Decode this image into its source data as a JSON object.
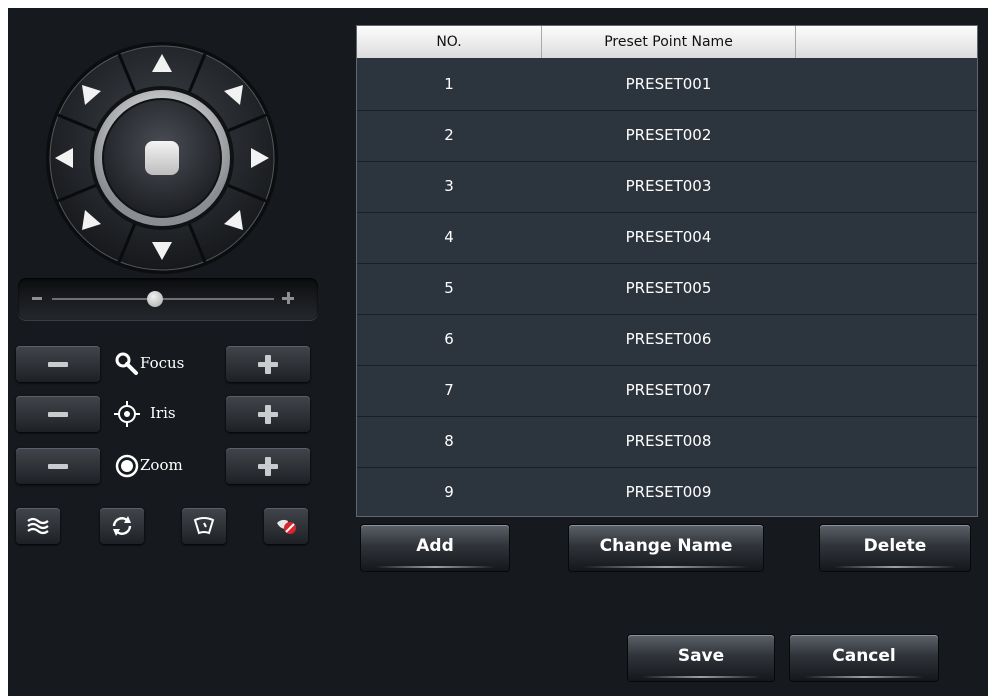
{
  "ptz": {
    "directions": [
      "up",
      "up-right",
      "right",
      "down-right",
      "down",
      "down-left",
      "left",
      "up-left"
    ]
  },
  "speed_slider": {
    "value_fraction": 0.5
  },
  "controls": [
    {
      "label": "Focus",
      "icon": "focus-icon"
    },
    {
      "label": "Iris",
      "icon": "iris-icon"
    },
    {
      "label": "Zoom",
      "icon": "zoom-icon"
    }
  ],
  "tools": [
    "wiper-icon",
    "auto-scan-icon",
    "light-icon",
    "clear-icon"
  ],
  "table": {
    "columns": [
      "NO.",
      "Preset Point Name",
      ""
    ],
    "rows": [
      {
        "no": "1",
        "name": "PRESET001"
      },
      {
        "no": "2",
        "name": "PRESET002"
      },
      {
        "no": "3",
        "name": "PRESET003"
      },
      {
        "no": "4",
        "name": "PRESET004"
      },
      {
        "no": "5",
        "name": "PRESET005"
      },
      {
        "no": "6",
        "name": "PRESET006"
      },
      {
        "no": "7",
        "name": "PRESET007"
      },
      {
        "no": "8",
        "name": "PRESET008"
      },
      {
        "no": "9",
        "name": "PRESET009"
      }
    ]
  },
  "actions": {
    "add": "Add",
    "change_name": "Change Name",
    "delete": "Delete"
  },
  "footer": {
    "save": "Save",
    "cancel": "Cancel"
  },
  "colors": {
    "panel": "#16191d",
    "table_bg": "#2c343e",
    "header_bg": "#f0f0f0"
  }
}
